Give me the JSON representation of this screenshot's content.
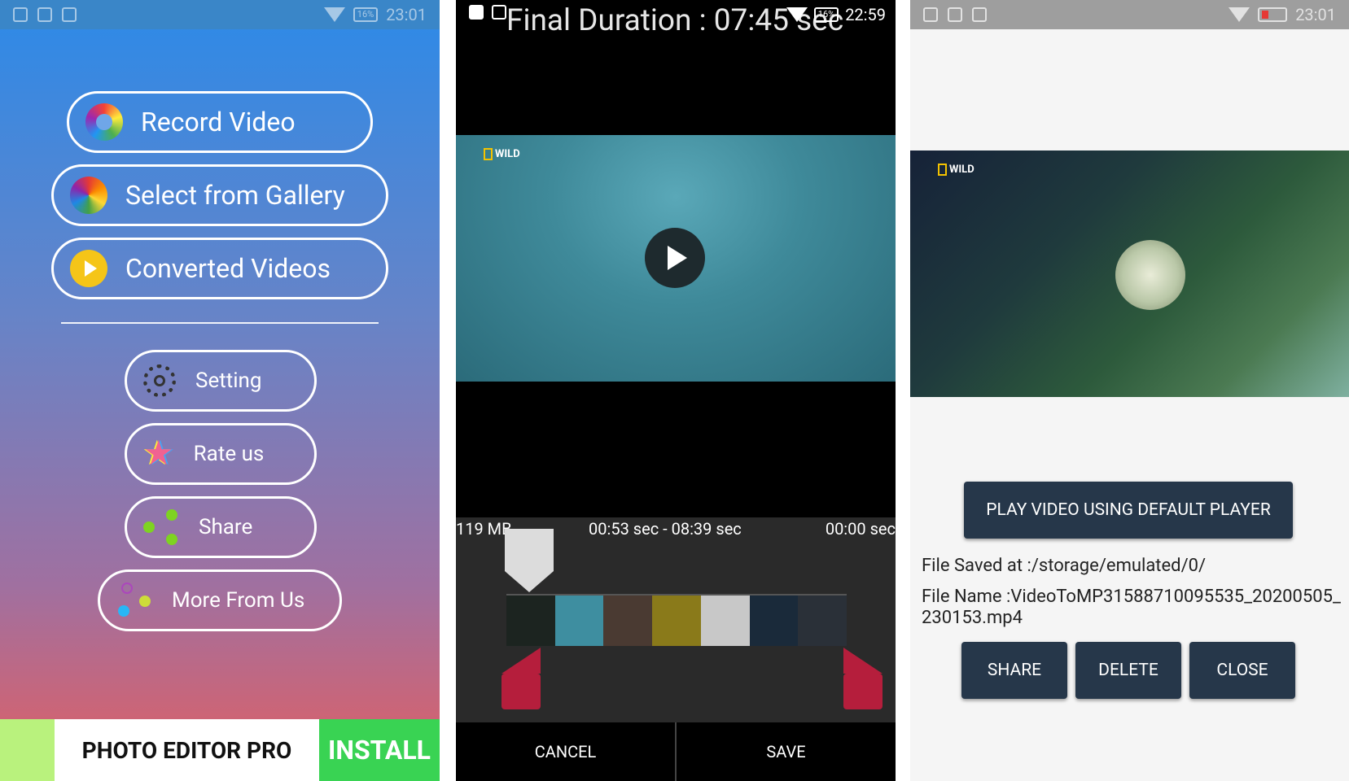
{
  "panel1": {
    "status": {
      "battery": "16%",
      "time": "23:01"
    },
    "main_buttons": [
      {
        "label": "Record Video",
        "icon": "aperture-icon"
      },
      {
        "label": "Select from Gallery",
        "icon": "flower-icon"
      },
      {
        "label": "Converted Videos",
        "icon": "play-circle-icon"
      }
    ],
    "menu_buttons": [
      {
        "label": "Setting",
        "icon": "gear-icon"
      },
      {
        "label": "Rate us",
        "icon": "star-icon"
      },
      {
        "label": "Share",
        "icon": "share-icon"
      },
      {
        "label": "More From Us",
        "icon": "molecule-icon"
      }
    ],
    "ad": {
      "title": "PHOTO EDITOR PRO",
      "cta": "INSTALL"
    }
  },
  "panel2": {
    "title": "Final Duration : 07:45 sec",
    "status": {
      "battery": "16%",
      "time": "22:59"
    },
    "video_logo": "WILD",
    "trim": {
      "size": "119 MB",
      "range": "00:53 sec - 08:39 sec",
      "position": "00:00 sec"
    },
    "buttons": {
      "cancel": "CANCEL",
      "save": "SAVE"
    }
  },
  "panel3": {
    "status": {
      "time": "23:01"
    },
    "video_logo": "WILD",
    "play_default": "PLAY VIDEO USING DEFAULT PLAYER",
    "file_saved": "File Saved at :/storage/emulated/0/",
    "file_name": "File Name :VideoToMP31588710095535_20200505_230153.mp4",
    "actions": {
      "share": "SHARE",
      "delete": "DELETE",
      "close": "CLOSE"
    }
  },
  "colors": {
    "ad_install_green": "#39d353",
    "trim_handle_red": "#b51e3c",
    "dark_button": "#26374a"
  }
}
